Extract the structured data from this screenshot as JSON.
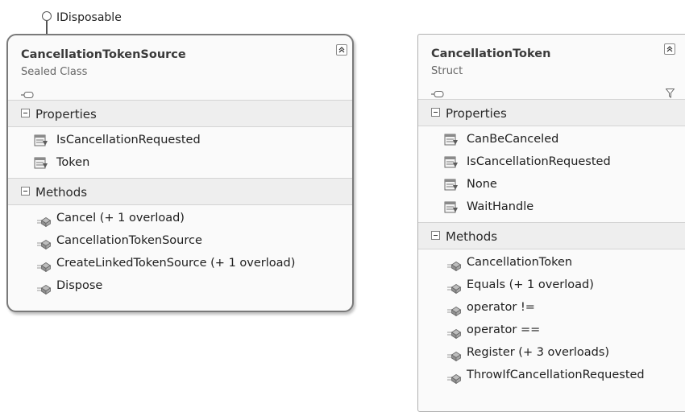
{
  "interface": {
    "label": "IDisposable"
  },
  "types": [
    {
      "name": "CancellationTokenSource",
      "stereotype": "Sealed Class",
      "compartments": [
        {
          "label": "Properties",
          "kind": "property",
          "members": [
            "IsCancellationRequested",
            "Token"
          ]
        },
        {
          "label": "Methods",
          "kind": "method",
          "members": [
            "Cancel (+ 1 overload)",
            "CancellationTokenSource",
            "CreateLinkedTokenSource (+ 1 overload)",
            "Dispose"
          ]
        }
      ]
    },
    {
      "name": "CancellationToken",
      "stereotype": "Struct",
      "compartments": [
        {
          "label": "Properties",
          "kind": "property",
          "members": [
            "CanBeCanceled",
            "IsCancellationRequested",
            "None",
            "WaitHandle"
          ]
        },
        {
          "label": "Methods",
          "kind": "method",
          "members": [
            "CancellationToken",
            "Equals (+ 1 overload)",
            "operator !=",
            "operator ==",
            "Register (+ 3 overloads)",
            "ThrowIfCancellationRequested"
          ]
        }
      ]
    }
  ],
  "icons": {
    "property": "property-icon",
    "method": "method-icon",
    "collapse": "collapse-chevron-icon",
    "pin": "pin-icon",
    "filter": "filter-icon",
    "interface": "interface-lollipop-icon"
  }
}
